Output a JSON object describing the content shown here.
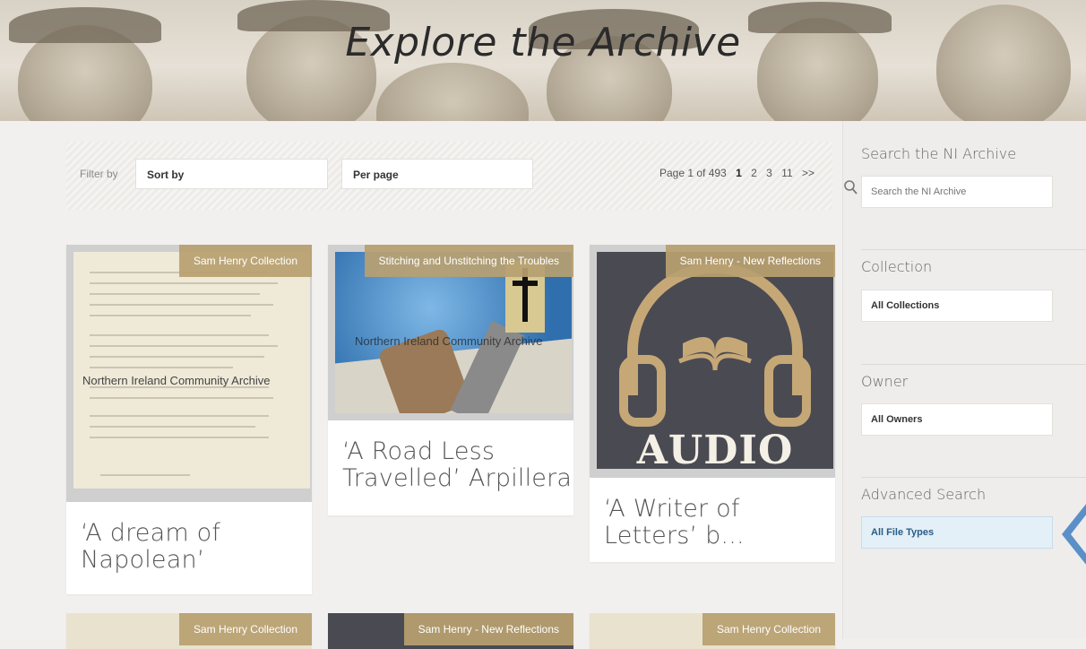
{
  "banner": {
    "title": "Explore the Archive"
  },
  "filters": {
    "filter_label": "Filter by",
    "sort_label": "Sort by",
    "perpage_label": "Per page"
  },
  "pagination": {
    "summary": "Page 1 of 493",
    "pages": [
      "1",
      "2",
      "3",
      "11",
      ">>"
    ],
    "current": "1"
  },
  "cards": [
    {
      "tag": "Sam Henry Collection",
      "title_line1": "‘A dream of",
      "title_line2": "Napolean’",
      "watermark": "Northern Ireland Community Archive"
    },
    {
      "tag": "Stitching and Unstitching the Troubles",
      "title_line1": "‘A Road Less",
      "title_line2": "Travelled’ Arpillera",
      "watermark": "Northern Ireland Community Archive"
    },
    {
      "tag": "Sam Henry - New Reflections",
      "title_line1": "‘A Writer of",
      "title_line2": "Letters’ b...",
      "thumb_text": "AUDIO"
    },
    {
      "tag": "Sam Henry Collection"
    },
    {
      "tag": "Sam Henry - New Reflections"
    },
    {
      "tag": "Sam Henry Collection"
    }
  ],
  "sidebar": {
    "search_heading": "Search the NI Archive",
    "search_placeholder": "Search the NI Archive",
    "collection_heading": "Collection",
    "collection_value": "All Collections",
    "owner_heading": "Owner",
    "owner_value": "All Owners",
    "advanced_heading": "Advanced Search",
    "advanced_value": "All File Types"
  },
  "colors": {
    "tag_bg": "#b7a070",
    "accent_blue": "#5b8fc7",
    "audio_bg": "#4a4a52",
    "audio_gold": "#c6a877"
  }
}
